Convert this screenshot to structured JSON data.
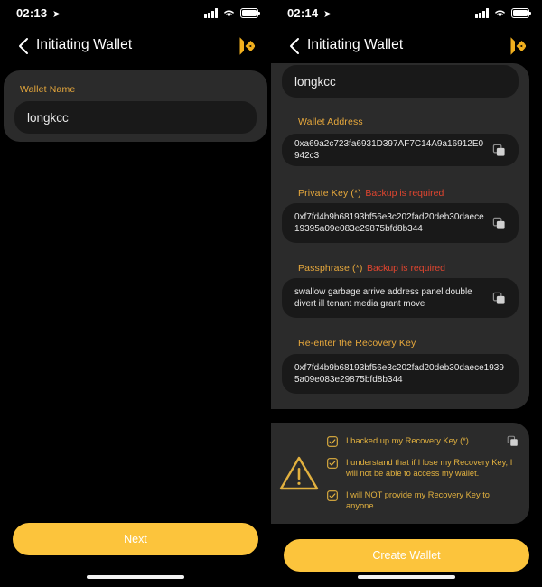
{
  "left_panel": {
    "status_bar": {
      "time": "02:13",
      "location_icon": "location-arrow-icon",
      "signal_icon": "signal-bars-icon",
      "wifi_icon": "wifi-icon",
      "battery_icon": "battery-full-icon"
    },
    "nav": {
      "back_icon": "chevron-left-icon",
      "title": "Initiating Wallet",
      "brand_icon": "kucoin-logo-icon"
    },
    "wallet_name": {
      "label": "Wallet Name",
      "value": "longkcc"
    },
    "cta": {
      "label": "Next"
    }
  },
  "right_panel": {
    "status_bar": {
      "time": "02:14",
      "location_icon": "location-arrow-icon",
      "signal_icon": "signal-bars-icon",
      "wifi_icon": "wifi-icon",
      "battery_icon": "battery-full-icon"
    },
    "nav": {
      "back_icon": "chevron-left-icon",
      "title": "Initiating Wallet",
      "brand_icon": "kucoin-logo-icon"
    },
    "wallet_name": {
      "value": "longkcc"
    },
    "wallet_address": {
      "label": "Wallet Address",
      "value": "0xa69a2c723fa6931D397AF7C14A9a16912E0942c3",
      "copy_icon": "copy-icon"
    },
    "private_key": {
      "label": "Private Key (*)",
      "warning": "Backup is required",
      "value": "0xf7fd4b9b68193bf56e3c202fad20deb30daece19395a09e083e29875bfd8b344",
      "copy_icon": "copy-icon"
    },
    "passphrase": {
      "label": "Passphrase (*)",
      "warning": "Backup is required",
      "value": "swallow garbage arrive address panel double divert ill tenant media grant move",
      "copy_icon": "copy-icon"
    },
    "recovery_key": {
      "label": "Re-enter the Recovery Key",
      "value": "0xf7fd4b9b68193bf56e3c202fad20deb30daece19395a09e083e29875bfd8b344"
    },
    "confirmations": {
      "warning_icon": "warning-triangle-icon",
      "items": [
        {
          "label": "I backed up my Recovery Key (*)",
          "checked": true,
          "checkbox_icon": "checkbox-checked-icon",
          "copy_icon": "copy-icon"
        },
        {
          "label": "I understand that if I lose my Recovery Key, I will not be able to access my wallet.",
          "checked": true,
          "checkbox_icon": "checkbox-checked-icon"
        },
        {
          "label": "I will NOT provide my Recovery Key to anyone.",
          "checked": true,
          "checkbox_icon": "checkbox-checked-icon"
        }
      ]
    },
    "cta": {
      "label": "Create Wallet"
    }
  },
  "colors": {
    "accent_yellow": "#fcc43c",
    "label_gold": "#e8a93c",
    "warning_red": "#e0452f",
    "card_bg": "#2b2b2b",
    "input_bg": "#191919",
    "page_bg": "#000000"
  }
}
